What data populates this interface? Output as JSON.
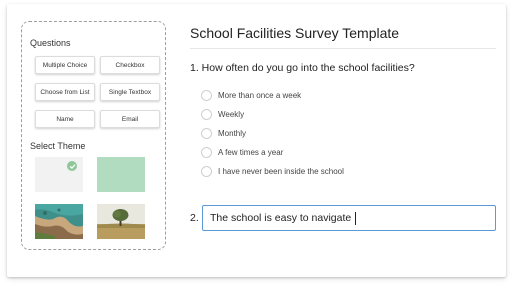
{
  "sidebar": {
    "questions_title": "Questions",
    "question_types": [
      {
        "label": "Multiple Choice"
      },
      {
        "label": "Checkbox"
      },
      {
        "label": "Choose from List"
      },
      {
        "label": "Single Textbox"
      },
      {
        "label": "Name"
      },
      {
        "label": "Email"
      }
    ],
    "theme_title": "Select Theme",
    "themes": [
      {
        "name": "plain-light",
        "selected": true,
        "color": "#f2f2f2"
      },
      {
        "name": "mint-green",
        "selected": false,
        "color": "#b2dcc0"
      },
      {
        "name": "coastline-photo",
        "selected": false
      },
      {
        "name": "tree-field-photo",
        "selected": false
      }
    ],
    "check_icon": "check-icon"
  },
  "survey": {
    "title": "School Facilities Survey Template",
    "q1": {
      "text": "1. How often do you go into the school facilities?",
      "options": [
        "More than once a week",
        "Weekly",
        "Monthly",
        "A few times a year",
        "I have never been inside the school"
      ]
    },
    "q2": {
      "number": "2.",
      "value": "The school is easy to navigate"
    }
  },
  "colors": {
    "accent_border": "#5b9bd5",
    "check_green": "#8fc79a",
    "mint_theme": "#b2dcc0"
  }
}
